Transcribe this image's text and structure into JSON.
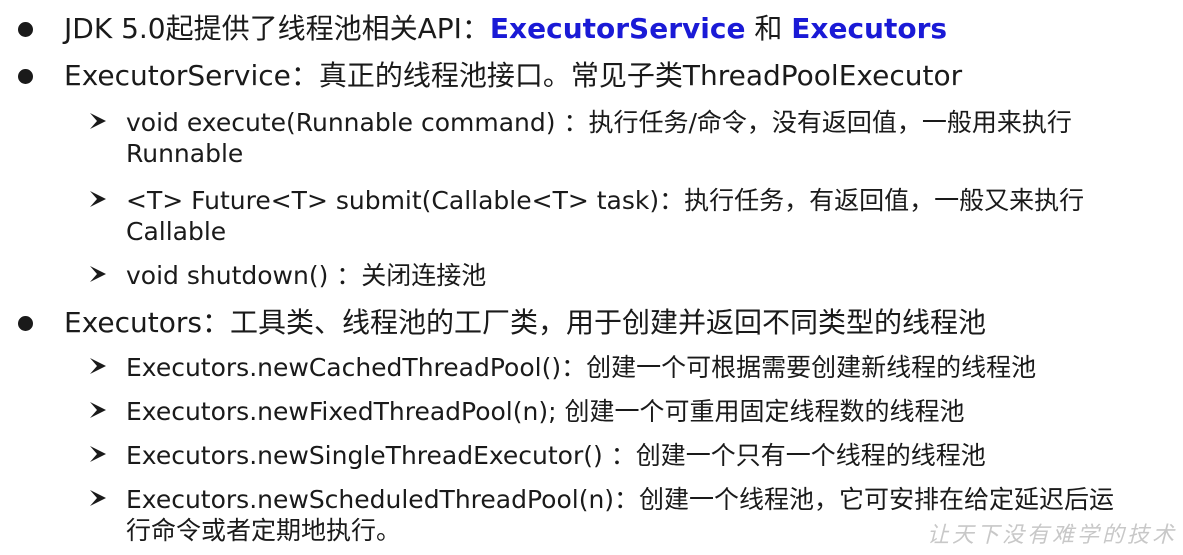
{
  "bullets": [
    {
      "id": "jdk",
      "prefix": "JDK 5.0起提供了线程池相关API：",
      "api1": "ExecutorService",
      "connector": " 和 ",
      "api2": "Executors"
    },
    {
      "id": "executor-service",
      "text": "ExecutorService：真正的线程池接口。常见子类ThreadPoolExecutor",
      "items": [
        {
          "text": "void execute(Runnable command) ：执行任务/命令，没有返回值，一般用来执行 Runnable"
        },
        {
          "text": "<T> Future<T> submit(Callable<T> task)：执行任务，有返回值，一般又来执行 Callable"
        },
        {
          "text": "void shutdown() ：关闭连接池"
        }
      ]
    },
    {
      "id": "executors",
      "text": "Executors：工具类、线程池的工厂类，用于创建并返回不同类型的线程池",
      "items": [
        {
          "text": "Executors.newCachedThreadPool()：创建一个可根据需要创建新线程的线程池"
        },
        {
          "text": "Executors.newFixedThreadPool(n); 创建一个可重用固定线程数的线程池"
        },
        {
          "text": "Executors.newSingleThreadExecutor() ：创建一个只有一个线程的线程池"
        },
        {
          "text": "Executors.newScheduledThreadPool(n)：创建一个线程池，它可安排在给定延迟后运行命令或者定期地执行。"
        }
      ]
    }
  ],
  "watermark": "让天下没有难学的技术",
  "colors": {
    "api_highlight": "#1a1ad6",
    "text": "#1a1a1a"
  },
  "icons": {
    "bullet": "filled-circle",
    "sub_bullet": "arrowhead-right"
  }
}
